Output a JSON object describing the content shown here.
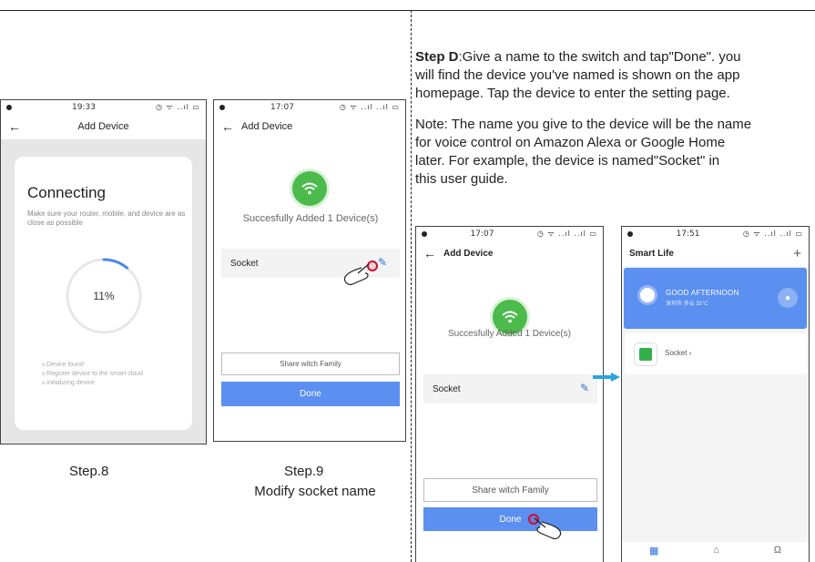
{
  "step8": {
    "status_time": "19:33",
    "status_icons": "◷ ᯤ ..ıl ▭",
    "title": "Add Device",
    "connecting": "Connecting",
    "description": "Make sure your router, mobile, and device are as close as possible",
    "progress_text": "11%",
    "progress": 0.11,
    "steps": [
      "Device found",
      "Register device to the smart cloud",
      "Initializing device"
    ],
    "caption": "Step.8"
  },
  "step9": {
    "status_time": "17:07",
    "status_icons": "◷ ᯤ ..ıl ..ıl ▭",
    "title": "Add Device",
    "success": "Succesfully Added 1 Device(s)",
    "device_name": "Socket",
    "share": "Share witch Family",
    "done": "Done",
    "caption_line1": "Step.9",
    "caption_line2": "Modify socket name"
  },
  "instructions": {
    "step_label": "Step D",
    "line1_rest": ":Give a name to the switch and tap\"Done\". you",
    "line2": "will find the device you've named is shown on the app",
    "line3": "homepage. Tap the device to enter the setting page.",
    "note1": "Note: The name you give to the device will be the name",
    "note2": "for voice control on Amazon Alexa or Google Home",
    "note3": "later. For example, the device is named\"Socket\" in",
    "note4": "this user guide."
  },
  "stepD_phone1": {
    "status_time": "17:07",
    "status_icons": "◷ ᯤ ..ıl ..ıl ▭",
    "title": "Add Device",
    "success": "Succesfully Added 1 Device(s)",
    "device_name": "Socket",
    "share": "Share witch Family",
    "done": "Done"
  },
  "stepD_phone2": {
    "status_time": "17:51",
    "status_icons": "◷ ᯤ ..ıl ..ıl ▭",
    "app_title": "Smart Life",
    "greeting": "GOOD AFTERNOON",
    "weather_sub": "深圳市 多云 31°C",
    "device_label": "Socket ›"
  },
  "colors": {
    "accent": "#5b8ff0",
    "success": "#4cbb4c",
    "tap": "#c8102e",
    "arrow": "#2aa3e0"
  }
}
